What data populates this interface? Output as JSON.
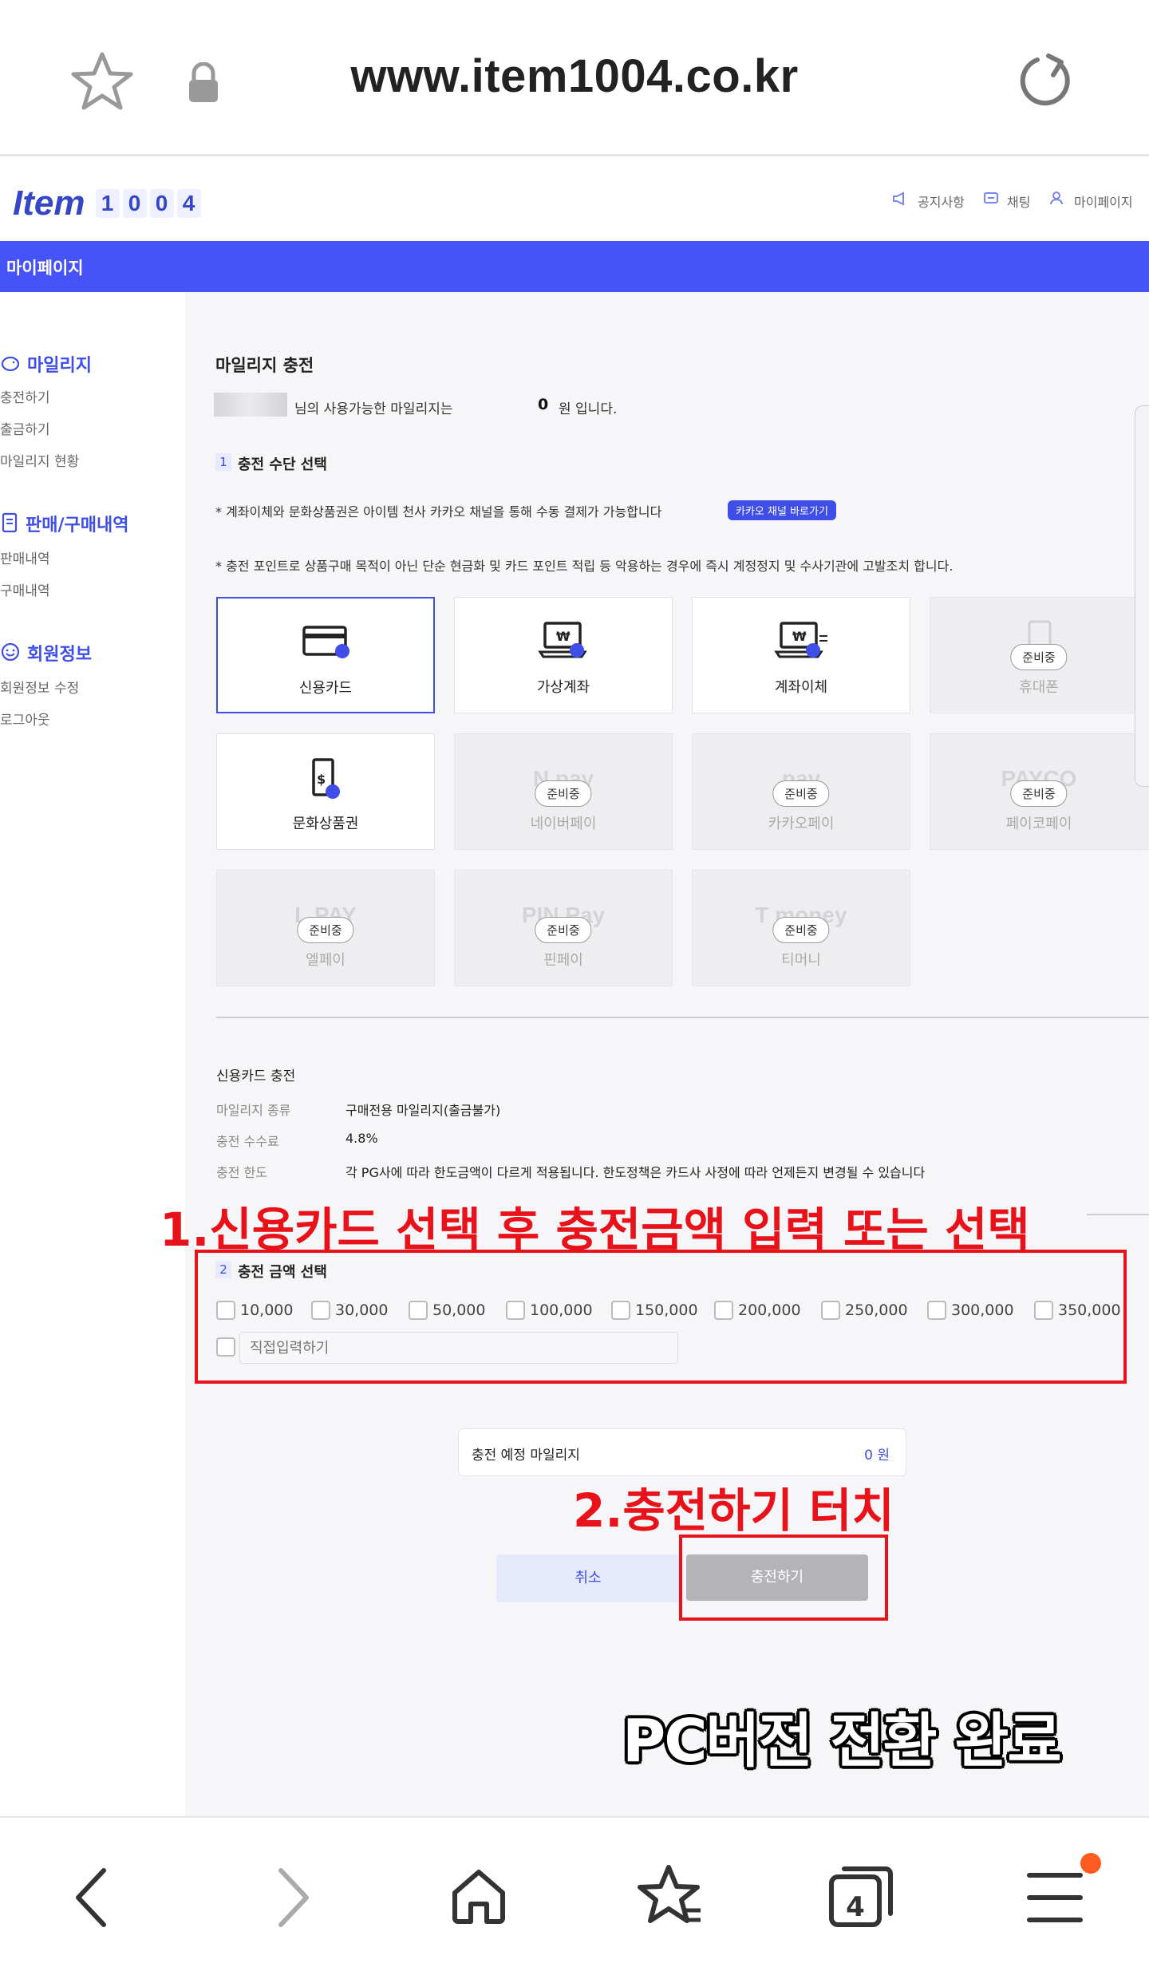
{
  "browser": {
    "url": "www.item1004.co.kr",
    "tab_count": "4"
  },
  "header": {
    "logo_word": "Item",
    "logo_digits": [
      "1",
      "0",
      "0",
      "4"
    ],
    "links": [
      "공지사항",
      "채팅",
      "마이페이지"
    ]
  },
  "title_bar": "마이페이지",
  "sidebar": {
    "groups": [
      {
        "title": "마일리지",
        "items": [
          "충전하기",
          "출금하기",
          "마일리지 현황"
        ]
      },
      {
        "title": "판매/구매내역",
        "items": [
          "판매내역",
          "구매내역"
        ]
      },
      {
        "title": "회원정보",
        "items": [
          "회원정보 수정",
          "로그아웃"
        ]
      }
    ]
  },
  "main": {
    "title": "마일리지 충전",
    "balance_prefix": "님의 사용가능한 마일리지는",
    "balance_value": "0",
    "balance_suffix": "원 입니다.",
    "step1_num": "1",
    "step1_label": "충전 수단 선택",
    "notice1": "* 계좌이체와 문화상품권은 아이템 천사 카카오 채널을 통해 수동 결제가 가능합니다",
    "kakao_button": "카카오 채널 바로가기",
    "notice2": "* 충전 포인트로 상품구매 목적이 아닌 단순 현금화 및 카드 포인트 적립 등 악용하는 경우에 즉시 계정정지 및 수사기관에 고발조치 합니다.",
    "methods": [
      {
        "label": "신용카드",
        "status": "selected"
      },
      {
        "label": "가상계좌",
        "status": "active"
      },
      {
        "label": "계좌이체",
        "status": "active"
      },
      {
        "label": "휴대폰",
        "status": "준비중"
      },
      {
        "label": "문화상품권",
        "status": "active"
      },
      {
        "label": "네이버페이",
        "status": "준비중",
        "ghost": "N pay"
      },
      {
        "label": "카카오페이",
        "status": "준비중",
        "ghost": "pay"
      },
      {
        "label": "페이코페이",
        "status": "준비중",
        "ghost": "PAYCO"
      },
      {
        "label": "엘페이",
        "status": "준비중",
        "ghost": "L.PAY"
      },
      {
        "label": "핀페이",
        "status": "준비중",
        "ghost": "PIN Pay"
      },
      {
        "label": "티머니",
        "status": "준비중",
        "ghost": "T money"
      }
    ],
    "card_section_title": "신용카드 충전",
    "info": [
      {
        "key": "마일리지 종류",
        "value": "구매전용 마일리지(출금불가)"
      },
      {
        "key": "충전 수수료",
        "value": "4.8%"
      },
      {
        "key": "충전 한도",
        "value": "각 PG사에 따라 한도금액이 다르게 적용됩니다. 한도정책은 카드사 사정에 따라 언제든지 변경될 수 있습니다"
      }
    ],
    "step2_num": "2",
    "step2_label": "충전 금액 선택",
    "amounts": [
      "10,000",
      "30,000",
      "50,000",
      "100,000",
      "150,000",
      "200,000",
      "250,000",
      "300,000",
      "350,000"
    ],
    "custom_placeholder": "직접입력하기",
    "expected_label": "충전 예정 마일리지",
    "expected_value": "0 원",
    "cancel_label": "취소",
    "submit_label": "충전하기"
  },
  "annotations": {
    "step1": "1.신용카드 선택 후 충전금액 입력 또는 선택",
    "step2": "2.충전하기 터치",
    "done": "PC버전 전환 완료"
  },
  "colors": {
    "brand_blue": "#4653f6",
    "annotation_red": "#e8121a"
  }
}
